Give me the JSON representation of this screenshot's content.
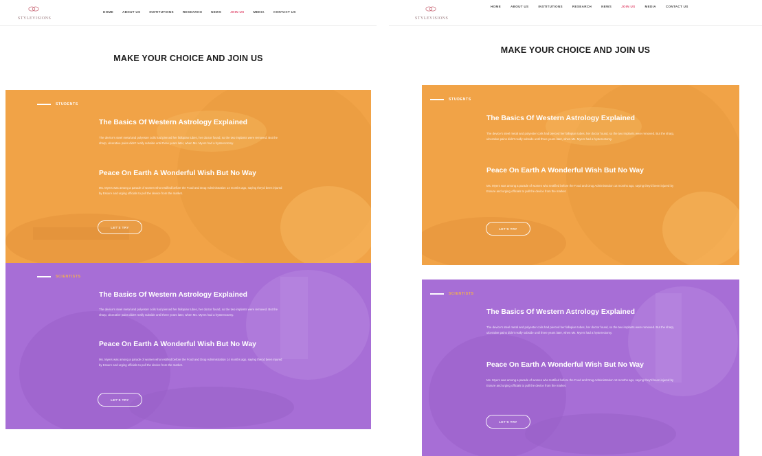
{
  "brand": {
    "logo_text": "STYLEVISIONS"
  },
  "nav": {
    "items": [
      "HOME",
      "ABOUT US",
      "INSTITUTIONS",
      "RESEARCH",
      "NEWS",
      "JOIN US",
      "MEDIA",
      "CONTACT US"
    ],
    "active_item": "JOIN US"
  },
  "page": {
    "title": "MAKE YOUR CHOICE AND JOIN US"
  },
  "sections": [
    {
      "label": "STUDENTS",
      "color": "#f1a347",
      "articles": [
        {
          "title": "The Basics Of Western Astrology Explained",
          "body": "The device's steel metal and polyester coils had pierced her fallopian tubes, her doctor found, so the two implants were removed. But the sharp, ulcerative pains didn't really subside until three years later, when Ms. Myers had a hysterectomy."
        },
        {
          "title": "Peace On Earth A Wonderful Wish But No Way",
          "body": "Ms. Myers was among a parade of women who testified before the Food and Drug Administration 14 months ago, saying they'd been injured by Essure and urging officials to pull the device from the market."
        }
      ],
      "cta": "LET'S TRY"
    },
    {
      "label": "SCIENTISTS",
      "color": "#a76ed6",
      "articles": [
        {
          "title": "The Basics Of Western Astrology Explained",
          "body": "The device's steel metal and polyester coils had pierced her fallopian tubes, her doctor found, so the two implants were removed. But the sharp, ulcerative pains didn't really subside until three years later, when Ms. Myers had a hysterectomy."
        },
        {
          "title": "Peace On Earth A Wonderful Wish But No Way",
          "body": "Ms. Myers was among a parade of women who testified before the Food and Drug Administration 14 months ago, saying they'd been injured by Essure and urging officials to pull the device from the market."
        }
      ],
      "cta": "LET'S TRY"
    }
  ]
}
